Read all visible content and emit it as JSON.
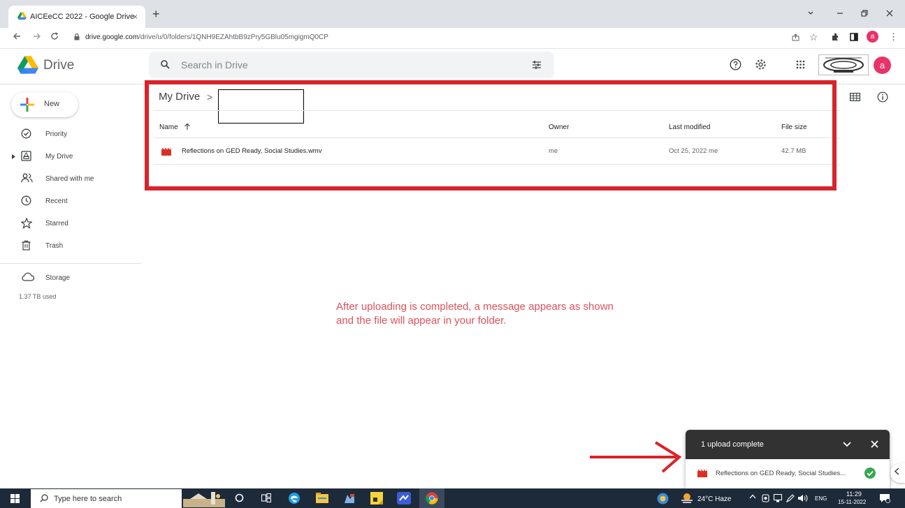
{
  "browser": {
    "tab_title": "AICEeCC 2022 - Google Drive",
    "tab_close": "×",
    "new_tab": "+",
    "url_host": "drive.google.com",
    "url_path": "/drive/u/0/folders/1QNH9EZAhtbB9zPry5GBlu05mgigmQ0CP",
    "profile_initial": "a"
  },
  "drive": {
    "app_name": "Drive",
    "search_placeholder": "Search in Drive",
    "avatar_initial": "a"
  },
  "sidebar": {
    "new_label": "New",
    "items": [
      {
        "label": "Priority",
        "icon": "priority-icon"
      },
      {
        "label": "My Drive",
        "icon": "my-drive-icon"
      },
      {
        "label": "Shared with me",
        "icon": "shared-icon"
      },
      {
        "label": "Recent",
        "icon": "clock-icon"
      },
      {
        "label": "Starred",
        "icon": "star-icon"
      },
      {
        "label": "Trash",
        "icon": "trash-icon"
      }
    ],
    "storage_label": "Storage",
    "storage_used": "1.37 TB used"
  },
  "main": {
    "breadcrumb_root": "My Drive",
    "breadcrumb_sep": ">",
    "columns": {
      "name": "Name",
      "owner": "Owner",
      "last_modified": "Last modified",
      "file_size": "File size"
    },
    "files": [
      {
        "name": "Reflections on GED Ready, Social Studies.wmv",
        "owner": "me",
        "modified": "Oct 25, 2022 me",
        "size": "42.7 MB"
      }
    ]
  },
  "annotation": {
    "line1": "After uploading is completed, a message appears as shown",
    "line2": "and the  file will appear in your folder."
  },
  "upload": {
    "title": "1 upload complete",
    "file": "Reflections on GED Ready, Social Studies..."
  },
  "taskbar": {
    "search_text": "Type here to search",
    "weather": "24°C  Haze",
    "language": "ENG",
    "time": "11:29",
    "date": "15-11-2022"
  },
  "colors": {
    "highlight": "#d9232a",
    "annotation": "#e0505a",
    "drive_red": "#db4437",
    "check_green": "#34a853"
  }
}
